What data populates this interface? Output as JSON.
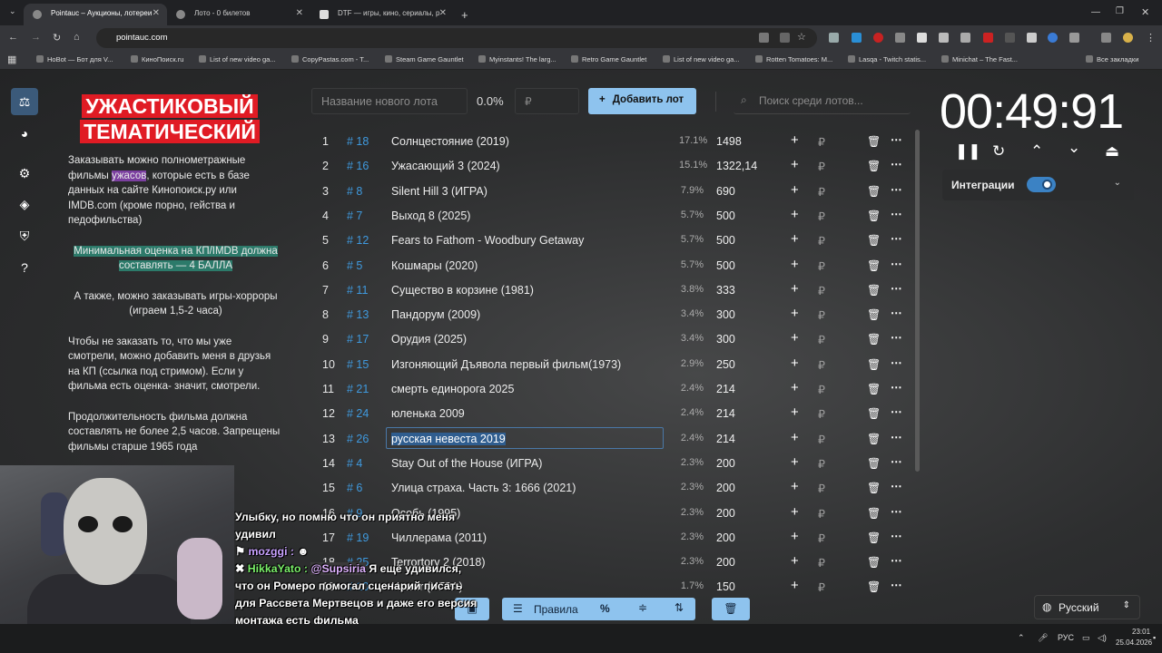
{
  "browser": {
    "tabs": [
      {
        "label": "Pointauc – Аукционы, лотереи",
        "active": true
      },
      {
        "label": "Лото - 0 билетов",
        "active": false
      },
      {
        "label": "DTF — игры, кино, сериалы, р",
        "active": false
      }
    ],
    "url": "pointauc.com",
    "bookmarks": [
      "HoBot — Бот для V...",
      "КиноПоиск.ru",
      "List of new video ga...",
      "CopyPastas.com - T...",
      "Steam Game Gauntlet",
      "Myinstants! The larg...",
      "Retro Game Gauntlet",
      "List of new video ga...",
      "Rotten Tomatoes: M...",
      "Lasqa - Twitch statis...",
      "Minichat – The Fast...",
      "Все закладки"
    ]
  },
  "rules": {
    "title_line1": "УЖАСТИКОВЫЙ",
    "title_line2": "ТЕМАТИЧЕСКИЙ",
    "p1_a": "Заказывать можно полнометражные фильмы ",
    "p1_hl": "ужасов",
    "p1_b": ", которые есть в базе данных на сайте Кинопоиск.ру или IMDB.com (кроме порно, гейства и педофильства)",
    "p2": "Минимальная оценка на КП/IMDB должна составлять — 4 БАЛЛА",
    "p3": "А также, можно заказывать игры-хорроры (играем 1,5-2 часа)",
    "p4": "Чтобы не заказать то, что мы уже смотрели, можно добавить меня в друзья на КП (ссылка под стримом). Если у фильма есть оценка- значит, смотрели.",
    "p5": "Продолжительность фильма должна составлять не более 2,5 часов. Запрещены фильмы старше 1965 года"
  },
  "toolbar": {
    "lot_placeholder": "Название нового лота",
    "percent": "0.0%",
    "rub_placeholder": "₽",
    "add_label": "Добавить лот",
    "search_placeholder": "Поиск среди лотов..."
  },
  "lots": [
    {
      "num": "1",
      "id": "# 18",
      "name": "Солнцестояние (2019)",
      "pct": "17.1%",
      "amount": "1498"
    },
    {
      "num": "2",
      "id": "# 16",
      "name": "Ужасающий 3 (2024)",
      "pct": "15.1%",
      "amount": "1322,14"
    },
    {
      "num": "3",
      "id": "# 8",
      "name": "Silent Hill 3 (ИГРА)",
      "pct": "7.9%",
      "amount": "690"
    },
    {
      "num": "4",
      "id": "# 7",
      "name": "Выход 8 (2025)",
      "pct": "5.7%",
      "amount": "500"
    },
    {
      "num": "5",
      "id": "# 12",
      "name": "Fears to Fathom - Woodbury Getaway",
      "pct": "5.7%",
      "amount": "500"
    },
    {
      "num": "6",
      "id": "# 5",
      "name": "Кошмары (2020)",
      "pct": "5.7%",
      "amount": "500"
    },
    {
      "num": "7",
      "id": "# 11",
      "name": "Существо в корзине (1981)",
      "pct": "3.8%",
      "amount": "333"
    },
    {
      "num": "8",
      "id": "# 13",
      "name": "Пандорум (2009)",
      "pct": "3.4%",
      "amount": "300"
    },
    {
      "num": "9",
      "id": "# 17",
      "name": "Орудия (2025)",
      "pct": "3.4%",
      "amount": "300"
    },
    {
      "num": "10",
      "id": "# 15",
      "name": "Изгоняющий Дъявола первый фильм(1973)",
      "pct": "2.9%",
      "amount": "250"
    },
    {
      "num": "11",
      "id": "# 21",
      "name": "смерть единорога 2025",
      "pct": "2.4%",
      "amount": "214"
    },
    {
      "num": "12",
      "id": "# 24",
      "name": "юленька 2009",
      "pct": "2.4%",
      "amount": "214"
    },
    {
      "num": "13",
      "id": "# 26",
      "name": "русская невеста 2019",
      "pct": "2.4%",
      "amount": "214"
    },
    {
      "num": "14",
      "id": "# 4",
      "name": "Stay Out of the House (ИГРА)",
      "pct": "2.3%",
      "amount": "200"
    },
    {
      "num": "15",
      "id": "# 6",
      "name": "Улица страха. Часть 3: 1666 (2021)",
      "pct": "2.3%",
      "amount": "200"
    },
    {
      "num": "16",
      "id": "# 9",
      "name": "Особь (1995)",
      "pct": "2.3%",
      "amount": "200"
    },
    {
      "num": "17",
      "id": "# 19",
      "name": "Чиллерама (2011)",
      "pct": "2.3%",
      "amount": "200"
    },
    {
      "num": "18",
      "id": "# 25",
      "name": "Terrortory 2 (2018)",
      "pct": "2.3%",
      "amount": "200"
    },
    {
      "num": "19",
      "id": "# 10",
      "name": "Horror (ИГРА)",
      "pct": "1.7%",
      "amount": "150"
    }
  ],
  "row_icons": {
    "plus": "+",
    "rub": "₽",
    "more": "⋯"
  },
  "timer": {
    "value": "00:49:91"
  },
  "integrations": {
    "label": "Интеграции",
    "enabled": true
  },
  "bottom": {
    "rules_label": "Правила",
    "percent_icon": "%"
  },
  "language": {
    "value": "Русский"
  },
  "chat": {
    "line1": "Улыбку, но помню что он приятно меня удивил",
    "user1": "mozggi :",
    "user2": "HikkaYato :",
    "mention": "@Supsiria",
    "msg2": " Я ещё удивился, что он Ромеро помогал сценарий писать для Рассвета Мертвецов и даже его версия монтажа есть фильма"
  },
  "taskbar": {
    "lang": "РУС",
    "time": "23:01",
    "date": "25.04.2026"
  }
}
